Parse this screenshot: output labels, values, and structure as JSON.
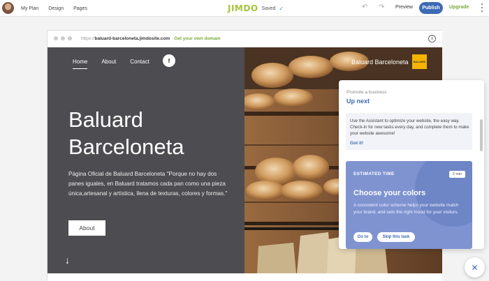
{
  "topbar": {
    "nav": [
      "My Plan",
      "Design",
      "Pages"
    ],
    "logo": "JIMDO",
    "saved": "Saved",
    "preview": "Preview",
    "publish": "Publish",
    "upgrade": "Upgrade"
  },
  "browser": {
    "url_prefix": "https://",
    "url_host": "baluard-barceloneta.jimdosite.com",
    "own_domain": "Get your own domain"
  },
  "site": {
    "nav": [
      "Home",
      "About",
      "Contact"
    ],
    "facebook": "f",
    "title_line1": "Baluard",
    "title_line2": "Barceloneta",
    "description": "Página Oficial de Baluard Barceloneta \"Porque no hay dos panes iguales, en Baluard tratamos cada pan como una pieza única,artesanal y artística, llena de texturas, colores y formas.\"",
    "about_button": "About",
    "brand_name": "Baluard Barceloneta",
    "logo_text": "BALUARD"
  },
  "assistant": {
    "kicker": "Promote a business",
    "title": "Up next",
    "tip_text": "Use the Assistant to optimize your website, the easy way. Check-in for new tasks every day, and complete them to make your website awesome!",
    "tip_link": "Got it!",
    "task_kicker": "ESTIMATED TIME",
    "task_badge": "2 min",
    "task_title": "Choose your colors",
    "task_desc": "A consistent color scheme helps your website match your brand, and sets the right mood for your visitors.",
    "goto": "Go to",
    "skip": "Skip this task"
  },
  "colors": {
    "accent": "#3d6ab5",
    "upgrade": "#7aa93a",
    "hero_dark": "#4d4d51",
    "task_card": "#7e93d0"
  }
}
